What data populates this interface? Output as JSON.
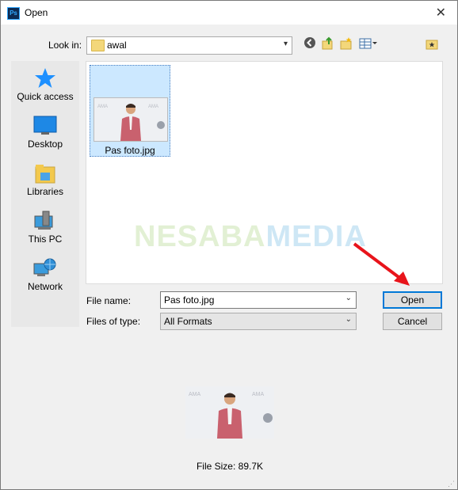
{
  "window": {
    "title": "Open",
    "app_icon_text": "Ps"
  },
  "lookin": {
    "label": "Look in:",
    "folder": "awal"
  },
  "toolbar": {
    "back_icon": "back-arrow-icon",
    "up_icon": "up-folder-icon",
    "new_folder_icon": "new-folder-icon",
    "view_icon": "view-menu-icon",
    "extra_icon": "favorites-folder-icon"
  },
  "places": [
    {
      "label": "Quick access",
      "icon": "quick-access-star-icon"
    },
    {
      "label": "Desktop",
      "icon": "desktop-icon"
    },
    {
      "label": "Libraries",
      "icon": "libraries-icon"
    },
    {
      "label": "This PC",
      "icon": "this-pc-icon"
    },
    {
      "label": "Network",
      "icon": "network-icon"
    }
  ],
  "files": [
    {
      "name": "Pas foto.jpg"
    }
  ],
  "watermark": {
    "part1": "NESABA",
    "part2": "MEDIA"
  },
  "form": {
    "file_name_label": "File name:",
    "file_name_value": "Pas foto.jpg",
    "file_type_label": "Files of type:",
    "file_type_value": "All Formats"
  },
  "buttons": {
    "open": "Open",
    "cancel": "Cancel"
  },
  "preview": {
    "file_size": "File Size: 89.7K"
  },
  "colors": {
    "selection": "#cce8ff",
    "accent": "#0078d7",
    "arrow": "#e8141b"
  }
}
